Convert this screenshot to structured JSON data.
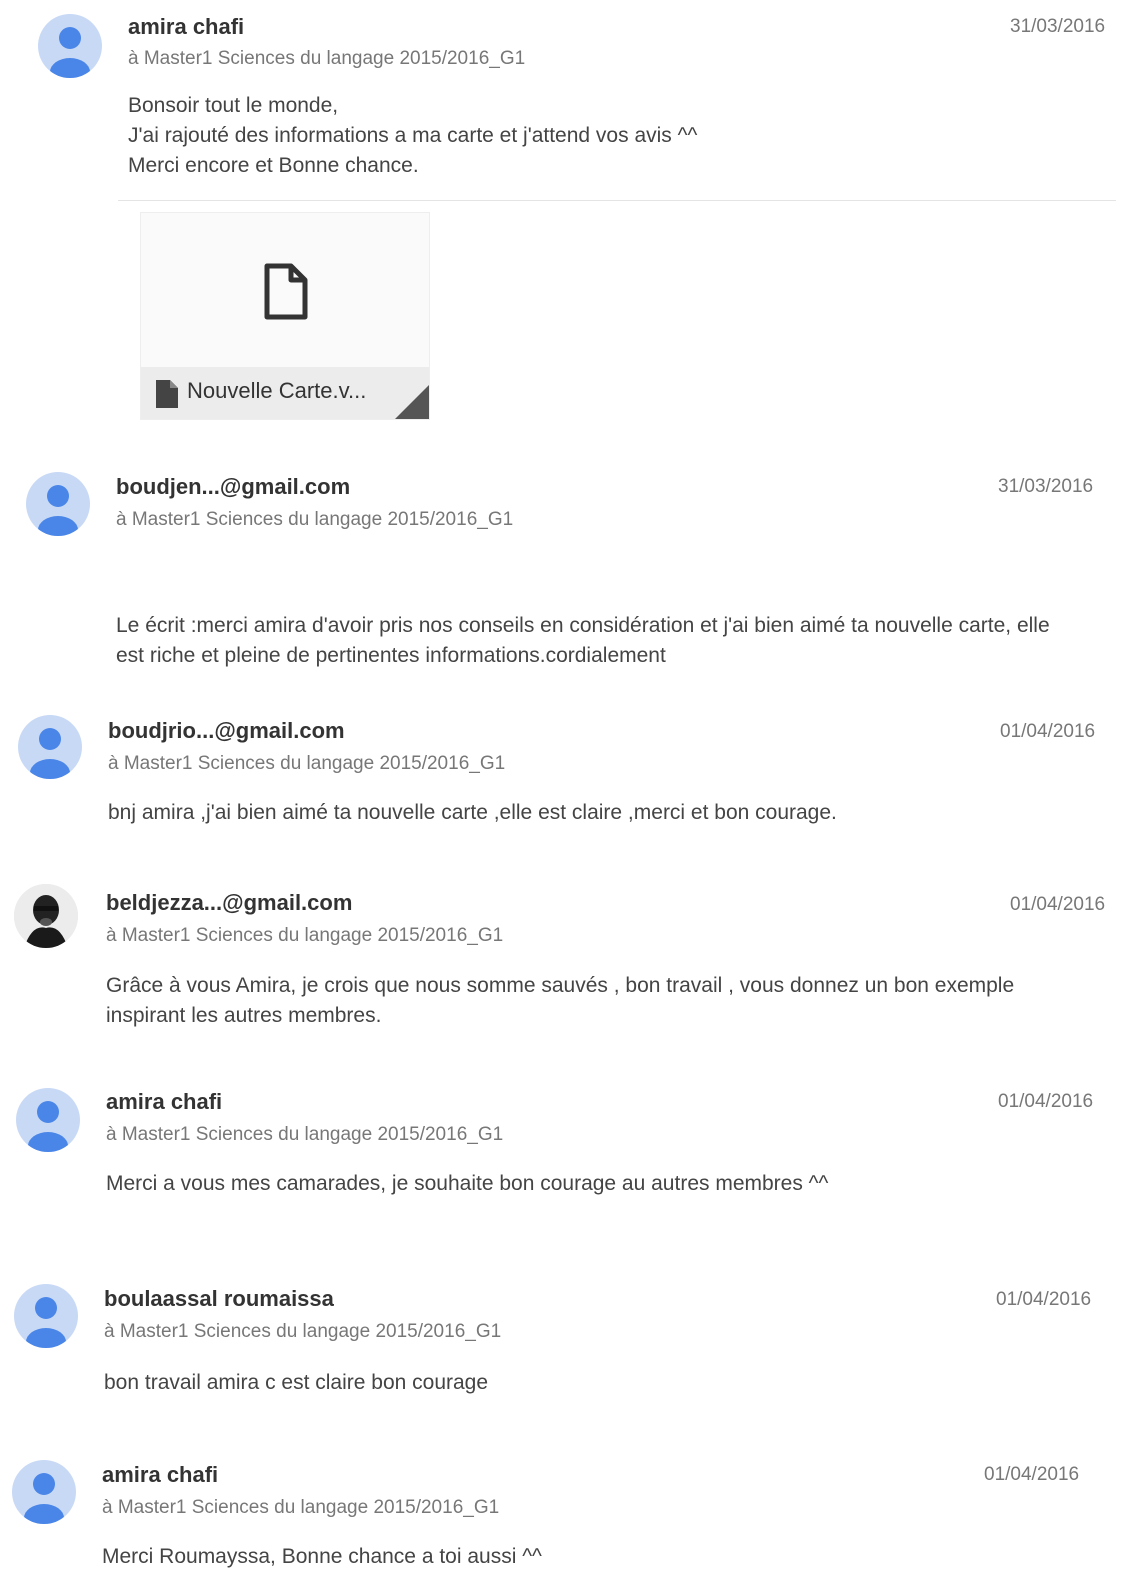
{
  "colors": {
    "avatar_bg": "#c8d9f6",
    "avatar_fg": "#4a86e8"
  },
  "posts": [
    {
      "author": "amira chafi",
      "audience": "à Master1 Sciences du langage 2015/2016_G1",
      "date": "31/03/2016",
      "body": "Bonsoir tout le monde,\n J'ai rajouté des informations a ma carte et j'attend vos avis ^^\nMerci encore et Bonne chance.",
      "avatar_icon": "person-icon",
      "attachment": {
        "file_name": "Nouvelle Carte.v...",
        "icon": "file-icon"
      }
    },
    {
      "author": "boudjen...@gmail.com",
      "audience": "à Master1 Sciences du langage 2015/2016_G1",
      "date": "31/03/2016",
      "body": "Le écrit :merci amira d'avoir pris nos conseils en considération et j'ai bien aimé ta nouvelle carte, elle\nest riche et pleine  de pertinentes informations.cordialement",
      "avatar_icon": "person-icon"
    },
    {
      "author": "boudjrio...@gmail.com",
      "audience": "à Master1 Sciences du langage 2015/2016_G1",
      "date": "01/04/2016",
      "body": "bnj amira ,j'ai bien aimé ta nouvelle carte ,elle est claire ,merci et bon courage.",
      "avatar_icon": "person-icon"
    },
    {
      "author": "beldjezza...@gmail.com",
      "audience": "à Master1 Sciences du langage 2015/2016_G1",
      "date": "01/04/2016",
      "body": "Grâce à vous Amira, je crois que nous somme sauvés , bon travail , vous donnez un bon exemple\ninspirant les autres membres.",
      "avatar_icon": "profile-photo"
    },
    {
      "author": "amira chafi",
      "audience": "à Master1 Sciences du langage 2015/2016_G1",
      "date": "01/04/2016",
      "body": "Merci a vous mes camarades, je souhaite bon courage au autres membres ^^",
      "avatar_icon": "person-icon"
    },
    {
      "author": "boulaassal roumaissa",
      "audience": "à Master1 Sciences du langage 2015/2016_G1",
      "date": "01/04/2016",
      "body": "bon travail amira c est claire bon courage",
      "avatar_icon": "person-icon"
    },
    {
      "author": "amira chafi",
      "audience": "à Master1 Sciences du langage 2015/2016_G1",
      "date": "01/04/2016",
      "body": "Merci Roumayssa, Bonne chance a toi aussi ^^",
      "avatar_icon": "person-icon"
    }
  ]
}
